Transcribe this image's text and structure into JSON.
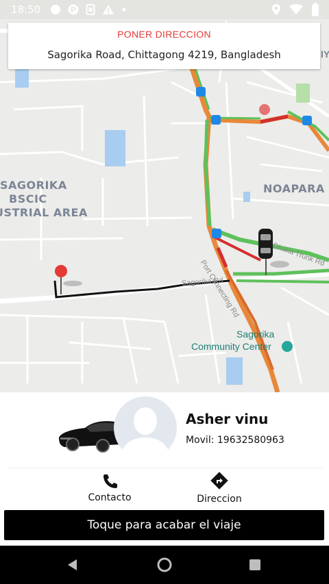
{
  "status_bar": {
    "time": "18:50",
    "left_icons": [
      "circle-icon",
      "parking-p-icon",
      "sim-card-icon",
      "warning-icon",
      "dot-icon"
    ],
    "right_icons": [
      "location-icon",
      "wifi-icon",
      "battery-icon"
    ]
  },
  "address_card": {
    "title": "PONER DIRECCION",
    "address": "Sagorika Road, Chittagong 4219, Bangladesh"
  },
  "map": {
    "labels": {
      "sagorika_area_1": "SAGORIKA",
      "sagorika_area_2": "BSCIC",
      "sagorika_area_3": "USTRIAL AREA",
      "noapara": "NOAPARA",
      "sagorika_rd": "Sagorika Rd",
      "dhaka_trunk_rd": "Dhaka Trunk Rd",
      "port_connecting_rd": "Port Connecting Rd",
      "community_1": "Sagorika",
      "community_2": "Community Center",
      "edge_label": "IY"
    },
    "colors": {
      "route": "#111111",
      "traffic_green": "#5ec15b",
      "traffic_orange": "#e8883a",
      "traffic_red": "#d32f2f",
      "pin": "#e53935",
      "water": "#a8cdf0",
      "park": "#b7dfa8"
    }
  },
  "driver": {
    "name": "Asher vinu",
    "phone": "Movil: 19632580963"
  },
  "actions": {
    "contact_label": "Contacto",
    "direction_label": "Direccion"
  },
  "end_trip": {
    "label": "Toque para acabar el viaje"
  },
  "nav_bar": {
    "buttons": [
      "back-icon",
      "home-icon",
      "recents-icon"
    ]
  }
}
